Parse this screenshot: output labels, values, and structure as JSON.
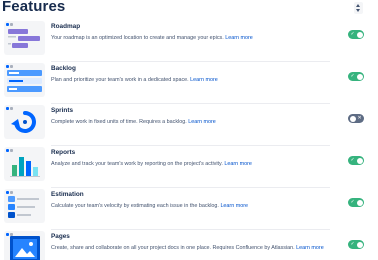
{
  "header": {
    "title": "Features"
  },
  "colors": {
    "accent": "#0052cc",
    "toggle_on": "#36b37e",
    "toggle_off": "#5e6c84"
  },
  "features": [
    {
      "name": "Roadmap",
      "desc": "Your roadmap is an optimized location to create and manage your epics.",
      "learn": "Learn more",
      "enabled": true,
      "icon": "roadmap-icon"
    },
    {
      "name": "Backlog",
      "desc": "Plan and prioritize your team's work in a dedicated space.",
      "learn": "Learn more",
      "enabled": true,
      "icon": "backlog-icon"
    },
    {
      "name": "Sprints",
      "desc": "Complete work in fixed units of time. Requires a backlog.",
      "learn": "Learn more",
      "enabled": false,
      "icon": "sprints-icon"
    },
    {
      "name": "Reports",
      "desc": "Analyze and track your team's work by reporting on the project's activity.",
      "learn": "Learn more",
      "enabled": true,
      "icon": "reports-icon"
    },
    {
      "name": "Estimation",
      "desc": "Calculate your team's velocity by estimating each issue in the backlog.",
      "learn": "Learn more",
      "enabled": true,
      "icon": "estimation-icon"
    },
    {
      "name": "Pages",
      "desc": "Create, share and collaborate on all your project docs in one place. Requires Confluence by Atlassian.",
      "learn": "Learn more",
      "enabled": true,
      "icon": "pages-icon"
    }
  ]
}
